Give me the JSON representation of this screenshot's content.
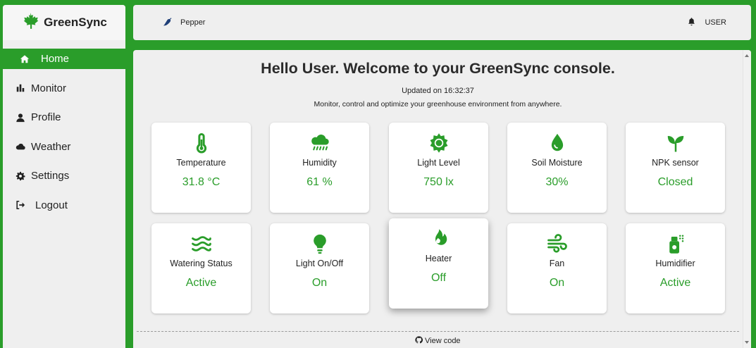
{
  "brand": {
    "name": "GreenSync",
    "icon": "maple-leaf-icon",
    "color": "#2a9d2a"
  },
  "sidebar": {
    "items": [
      {
        "label": "Home",
        "icon": "home-icon",
        "active": true
      },
      {
        "label": "Monitor",
        "icon": "bar-chart-icon"
      },
      {
        "label": "Profile",
        "icon": "user-icon"
      },
      {
        "label": "Weather",
        "icon": "cloud-icon"
      },
      {
        "label": "Settings",
        "icon": "gear-icon"
      },
      {
        "label": "Logout",
        "icon": "logout-icon"
      }
    ]
  },
  "topbar": {
    "project": "Pepper",
    "project_icon": "pepper-icon",
    "user": "USER",
    "user_icon": "bell-icon"
  },
  "main": {
    "title": "Hello User. Welcome to your GreenSync console.",
    "updated": "Updated on 16:32:37",
    "tagline": "Monitor, control and optimize your greenhouse environment from anywhere.",
    "view_code": "View code"
  },
  "sensors": [
    {
      "label": "Temperature",
      "value": "31.8 °C",
      "icon": "thermometer-icon"
    },
    {
      "label": "Humidity",
      "value": "61 %",
      "icon": "cloud-rain-icon"
    },
    {
      "label": "Light Level",
      "value": "750 lx",
      "icon": "sun-icon"
    },
    {
      "label": "Soil Moisture",
      "value": "30%",
      "icon": "droplet-icon"
    },
    {
      "label": "NPK sensor",
      "value": "Closed",
      "icon": "seedling-icon"
    }
  ],
  "controls": [
    {
      "label": "Watering Status",
      "value": "Active",
      "icon": "water-waves-icon"
    },
    {
      "label": "Light On/Off",
      "value": "On",
      "icon": "lightbulb-icon"
    },
    {
      "label": "Heater",
      "value": "Off",
      "icon": "fire-icon"
    },
    {
      "label": "Fan",
      "value": "On",
      "icon": "wind-icon"
    },
    {
      "label": "Humidifier",
      "value": "Active",
      "icon": "spray-can-icon"
    }
  ],
  "colors": {
    "accent": "#2a9d2a",
    "panel": "#efefef",
    "card": "#ffffff"
  }
}
